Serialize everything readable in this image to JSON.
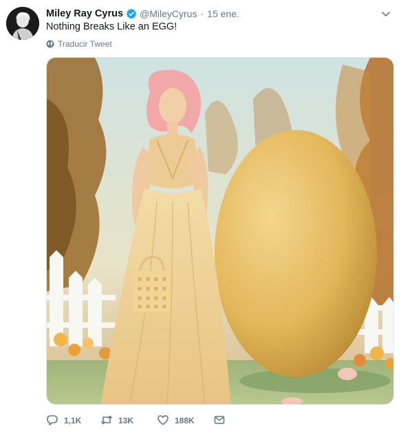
{
  "tweet": {
    "author_name": "Miley Ray Cyrus",
    "handle": "@MileyCyrus",
    "separator": "·",
    "timestamp": "15 ene.",
    "text": "Nothing Breaks Like an EGG!",
    "translate_label": "Traducir Tweet",
    "verified": true
  },
  "actions": {
    "replies": "1,1K",
    "retweets": "13K",
    "likes": "188K"
  },
  "icons": {
    "verified": "verified-badge-icon",
    "caret": "chevron-down-icon",
    "globe": "globe-icon",
    "reply": "reply-icon",
    "retweet": "retweet-icon",
    "like": "heart-icon",
    "dm": "envelope-icon"
  },
  "colors": {
    "accent": "#1da1f2",
    "secondary_text": "#657786",
    "primary_text": "#14171a"
  }
}
